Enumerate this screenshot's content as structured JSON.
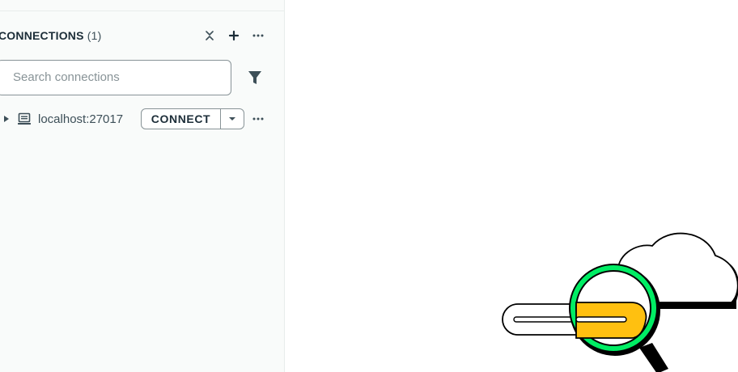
{
  "sidebar": {
    "connections_header": {
      "title": "CONNECTIONS",
      "count": "(1)",
      "icons": [
        "collapse-all-icon",
        "plus-icon",
        "ellipsis-icon"
      ]
    },
    "search": {
      "placeholder": "Search connections",
      "value": ""
    },
    "filter_icon": "filter-icon",
    "connections": [
      {
        "name": "localhost:27017",
        "icon": "laptop-icon",
        "connect_label": "CONNECT",
        "dropdown_icon": "caret-down-icon",
        "more_icon": "ellipsis-icon"
      }
    ]
  },
  "illustration": {
    "name": "magnifying-glass-cloud-illustration",
    "colors": {
      "accent_green": "#00ED64",
      "accent_yellow": "#FFC010",
      "outline": "#000000"
    }
  },
  "colors": {
    "sidebar_bg": "#F9FBFA",
    "border": "#889397",
    "text_primary": "#1C2D38",
    "text_secondary": "#3D4F58"
  }
}
